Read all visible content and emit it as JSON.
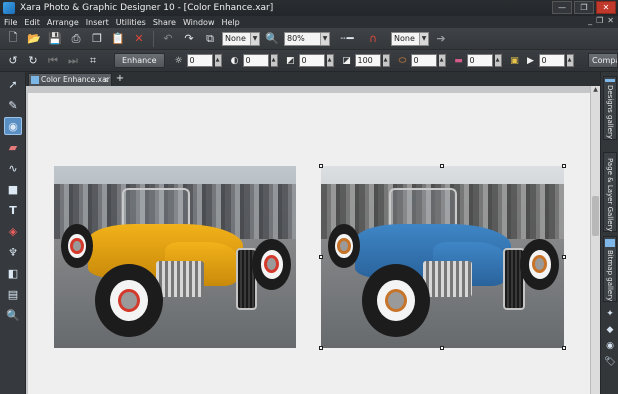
{
  "window": {
    "title": "Xara Photo & Graphic Designer 10 - [Color Enhance.xar]",
    "controls": [
      "—",
      "❐",
      "✕"
    ],
    "mdi_controls": [
      "_",
      "❐",
      "✕"
    ]
  },
  "menu": [
    "File",
    "Edit",
    "Arrange",
    "Insert",
    "Utilities",
    "Share",
    "Window",
    "Help"
  ],
  "toolbar": {
    "icons": [
      "new-document-icon",
      "open-folder-icon",
      "save-icon",
      "print-icon",
      "copy-icon",
      "paste-icon",
      "delete-icon",
      "undo-icon",
      "redo-icon",
      "transform-icon",
      "zoom-icon",
      "line-width-icon",
      "magnet-icon",
      "arrow-right-icon"
    ],
    "quality_value": "None",
    "zoom_value": "80%",
    "snap_value": "None"
  },
  "infobar": {
    "enhance_label": "Enhance",
    "fields": [
      {
        "name": "brightness",
        "value": "0"
      },
      {
        "name": "contrast",
        "value": "0"
      },
      {
        "name": "saturation",
        "value": "0"
      },
      {
        "name": "shadow",
        "value": "100"
      },
      {
        "name": "temperature",
        "value": "0"
      },
      {
        "name": "tint",
        "value": "0"
      },
      {
        "name": "sharpen",
        "value": "0"
      }
    ],
    "compare_label": "Compa"
  },
  "tools": [
    "selector-tool-icon",
    "freehand-pen-tool-icon",
    "photo-tool-icon",
    "eraser-tool-icon",
    "shape-editor-tool-icon",
    "rectangle-tool-icon",
    "text-tool-icon",
    "fill-tool-icon",
    "transparency-tool-icon",
    "shadow-tool-icon",
    "mould-tool-icon",
    "zoom-tool-icon"
  ],
  "document_tab": {
    "label": "Color Enhance.xar",
    "close": "x",
    "new_tab": "+"
  },
  "galleries": [
    {
      "label": "Designs gallery"
    },
    {
      "label": "Page & Layer Gallery"
    },
    {
      "label": "Bitmap gallery"
    }
  ],
  "canvas": {
    "photos": [
      {
        "name": "original-photo",
        "car_color": "#f2b21a",
        "car_shade": "#c98a0a",
        "rim_ring": "#d33a2c"
      },
      {
        "name": "enhanced-photo",
        "car_color": "#3f86c6",
        "car_shade": "#2a639c",
        "rim_ring": "#c7742a"
      }
    ]
  }
}
